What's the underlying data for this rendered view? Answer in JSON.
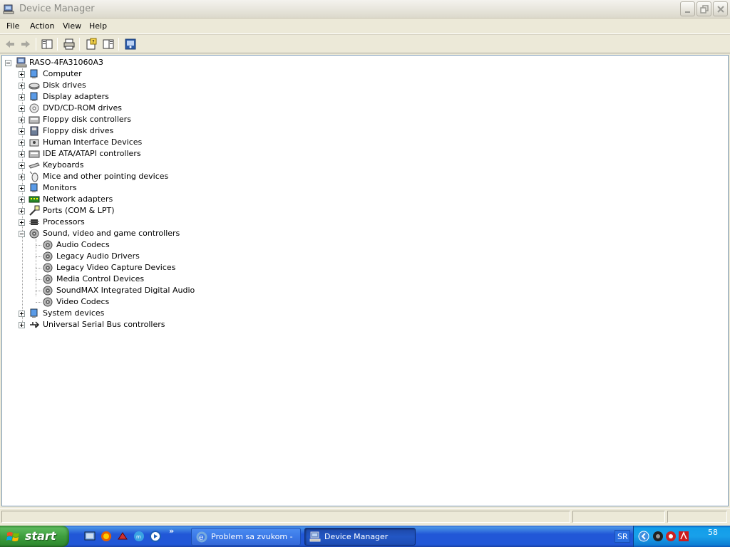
{
  "window": {
    "title": "Device Manager"
  },
  "menu": {
    "items": [
      "File",
      "Action",
      "View",
      "Help"
    ]
  },
  "toolbar": {
    "buttons": [
      "back-arrow-icon",
      "forward-arrow-icon",
      "show-hide-tree-icon",
      "print-icon",
      "properties-icon",
      "help-pane-icon",
      "scan-hardware-icon"
    ]
  },
  "tree": {
    "root": "RASO-4FA31060A3",
    "categories": [
      {
        "label": "Computer",
        "icon": "computer-icon",
        "expanded": false
      },
      {
        "label": "Disk drives",
        "icon": "disk-drive-icon",
        "expanded": false
      },
      {
        "label": "Display adapters",
        "icon": "display-adapter-icon",
        "expanded": false
      },
      {
        "label": "DVD/CD-ROM drives",
        "icon": "cdrom-icon",
        "expanded": false
      },
      {
        "label": "Floppy disk controllers",
        "icon": "floppy-controller-icon",
        "expanded": false
      },
      {
        "label": "Floppy disk drives",
        "icon": "floppy-drive-icon",
        "expanded": false
      },
      {
        "label": "Human Interface Devices",
        "icon": "hid-icon",
        "expanded": false
      },
      {
        "label": "IDE ATA/ATAPI controllers",
        "icon": "ide-controller-icon",
        "expanded": false
      },
      {
        "label": "Keyboards",
        "icon": "keyboard-icon",
        "expanded": false
      },
      {
        "label": "Mice and other pointing devices",
        "icon": "mouse-icon",
        "expanded": false
      },
      {
        "label": "Monitors",
        "icon": "monitor-icon",
        "expanded": false
      },
      {
        "label": "Network adapters",
        "icon": "network-adapter-icon",
        "expanded": false
      },
      {
        "label": "Ports (COM & LPT)",
        "icon": "port-icon",
        "expanded": false
      },
      {
        "label": "Processors",
        "icon": "processor-icon",
        "expanded": false
      },
      {
        "label": "Sound, video and game controllers",
        "icon": "sound-icon",
        "expanded": true,
        "children": [
          "Audio Codecs",
          "Legacy Audio Drivers",
          "Legacy Video Capture Devices",
          "Media Control Devices",
          "SoundMAX Integrated Digital Audio",
          "Video Codecs"
        ]
      },
      {
        "label": "System devices",
        "icon": "system-device-icon",
        "expanded": false
      },
      {
        "label": "Universal Serial Bus controllers",
        "icon": "usb-icon",
        "expanded": false
      }
    ]
  },
  "taskbar": {
    "start_label": "start",
    "tasks": [
      {
        "label": "Problem sa zvukom - ...",
        "icon": "internet-explorer-icon",
        "active": false
      },
      {
        "label": "Device Manager",
        "icon": "device-manager-icon",
        "active": true
      }
    ],
    "language": "SR",
    "clock": "58"
  },
  "colors": {
    "taskbar_blue": "#2157d7",
    "start_green": "#3e9e3e",
    "window_bg": "#ece9d8",
    "tree_bg": "#ffffff"
  }
}
